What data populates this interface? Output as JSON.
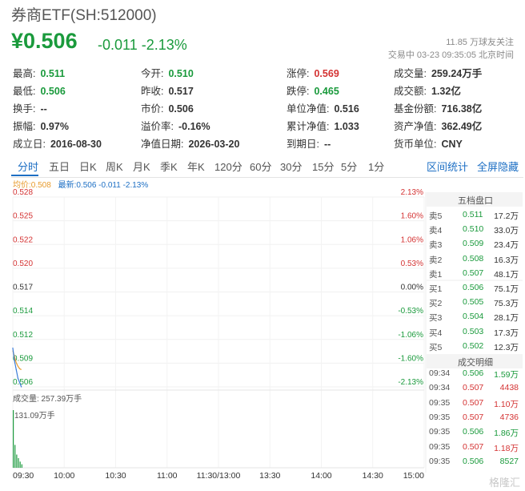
{
  "header": {
    "title": "券商ETF(SH:512000)",
    "price": "¥0.506",
    "change": "-0.011 -2.13%",
    "followers": "11.85 万球友关注",
    "status": "交易中 03-23 09:35:05 北京时间"
  },
  "quote": {
    "row1": [
      {
        "label": "最高:",
        "value": "0.511",
        "color": "#1a9a3c"
      },
      {
        "label": "今开:",
        "value": "0.510",
        "color": "#1a9a3c"
      },
      {
        "label": "涨停:",
        "value": "0.569",
        "color": "#d43333"
      },
      {
        "label": "成交量:",
        "value": "259.24万手",
        "color": "#333333"
      }
    ],
    "row2": [
      {
        "label": "最低:",
        "value": "0.506",
        "color": "#1a9a3c"
      },
      {
        "label": "昨收:",
        "value": "0.517",
        "color": "#333333"
      },
      {
        "label": "跌停:",
        "value": "0.465",
        "color": "#1a9a3c"
      },
      {
        "label": "成交额:",
        "value": "1.32亿",
        "color": "#333333"
      }
    ],
    "row3": [
      {
        "label": "换手:",
        "value": "--",
        "color": "#333333"
      },
      {
        "label": "市价:",
        "value": "0.506",
        "color": "#333333"
      },
      {
        "label": "单位净值:",
        "value": "0.516",
        "color": "#333333"
      },
      {
        "label": "基金份额:",
        "value": "716.38亿",
        "color": "#333333"
      }
    ],
    "row4": [
      {
        "label": "振幅:",
        "value": "0.97%",
        "color": "#333333"
      },
      {
        "label": "溢价率:",
        "value": "-0.16%",
        "color": "#333333"
      },
      {
        "label": "累计净值:",
        "value": "1.033",
        "color": "#333333"
      },
      {
        "label": "资产净值:",
        "value": "362.49亿",
        "color": "#333333"
      }
    ],
    "row5": [
      {
        "label": "成立日:",
        "value": "2016-08-30",
        "color": "#333333"
      },
      {
        "label": "净值日期:",
        "value": "2026-03-20",
        "color": "#333333"
      },
      {
        "label": "到期日:",
        "value": "--",
        "color": "#333333"
      },
      {
        "label": "货币单位:",
        "value": "CNY",
        "color": "#333333"
      }
    ]
  },
  "tabs": [
    "分时",
    "五日",
    "日K",
    "周K",
    "月K",
    "季K",
    "年K",
    "120分",
    "60分",
    "30分",
    "15分",
    "5分",
    "1分"
  ],
  "tabs_right": [
    "区间统计",
    "全屏隐藏"
  ],
  "legend": {
    "avg": "均价:0.508",
    "latest": "最新:0.506 -0.011 -2.13%"
  },
  "volume_label": "成交量: 257.39万手",
  "volume_axis_label": "131.09万手",
  "order_book": {
    "title": "五档盘口",
    "rows": [
      {
        "label": "卖5",
        "price": "0.511",
        "qty": "17.2万",
        "color": "#1a9a3c"
      },
      {
        "label": "卖4",
        "price": "0.510",
        "qty": "33.0万",
        "color": "#1a9a3c"
      },
      {
        "label": "卖3",
        "price": "0.509",
        "qty": "23.4万",
        "color": "#1a9a3c"
      },
      {
        "label": "卖2",
        "price": "0.508",
        "qty": "16.3万",
        "color": "#1a9a3c"
      },
      {
        "label": "卖1",
        "price": "0.507",
        "qty": "48.1万",
        "color": "#1a9a3c"
      },
      {
        "label": "买1",
        "price": "0.506",
        "qty": "75.1万",
        "color": "#1a9a3c"
      },
      {
        "label": "买2",
        "price": "0.505",
        "qty": "75.3万",
        "color": "#1a9a3c"
      },
      {
        "label": "买3",
        "price": "0.504",
        "qty": "28.1万",
        "color": "#1a9a3c"
      },
      {
        "label": "买4",
        "price": "0.503",
        "qty": "17.3万",
        "color": "#1a9a3c"
      },
      {
        "label": "买5",
        "price": "0.502",
        "qty": "12.3万",
        "color": "#1a9a3c"
      }
    ]
  },
  "trades": {
    "title": "成交明细",
    "rows": [
      {
        "time": "09:34",
        "price": "0.506",
        "vol": "1.59万",
        "color": "#1a9a3c"
      },
      {
        "time": "09:34",
        "price": "0.507",
        "vol": "4438",
        "color": "#d43333"
      },
      {
        "time": "09:35",
        "price": "0.507",
        "vol": "1.10万",
        "color": "#d43333"
      },
      {
        "time": "09:35",
        "price": "0.507",
        "vol": "4736",
        "color": "#d43333"
      },
      {
        "time": "09:35",
        "price": "0.506",
        "vol": "1.86万",
        "color": "#1a9a3c"
      },
      {
        "time": "09:35",
        "price": "0.507",
        "vol": "1.18万",
        "color": "#d43333"
      },
      {
        "time": "09:35",
        "price": "0.506",
        "vol": "8527",
        "color": "#1a9a3c"
      }
    ]
  },
  "watermark": "格隆汇",
  "chart_data": {
    "type": "line",
    "price_ticks": [
      "0.528",
      "0.525",
      "0.522",
      "0.520",
      "0.517",
      "0.514",
      "0.512",
      "0.509",
      "0.506"
    ],
    "pct_ticks": [
      "2.13%",
      "1.60%",
      "1.06%",
      "0.53%",
      "0.00%",
      "-0.53%",
      "-1.06%",
      "-1.60%",
      "-2.13%"
    ],
    "x_ticks": [
      "09:30",
      "10:00",
      "10:30",
      "11:00",
      "11:30/13:00",
      "13:30",
      "14:00",
      "14:30",
      "15:00"
    ],
    "ylim": [
      0.506,
      0.528
    ],
    "prev_close": 0.517,
    "price_series": [
      {
        "minute": 0,
        "value": 0.5105
      },
      {
        "minute": 1,
        "value": 0.509
      },
      {
        "minute": 2,
        "value": 0.508
      },
      {
        "minute": 3,
        "value": 0.507
      },
      {
        "minute": 4,
        "value": 0.5065
      },
      {
        "minute": 5,
        "value": 0.506
      }
    ],
    "avg_series": [
      {
        "minute": 0,
        "value": 0.5102
      },
      {
        "minute": 1,
        "value": 0.5095
      },
      {
        "minute": 2,
        "value": 0.5088
      },
      {
        "minute": 3,
        "value": 0.5084
      },
      {
        "minute": 4,
        "value": 0.5081
      },
      {
        "minute": 5,
        "value": 0.508
      }
    ],
    "volume_unit": "万手",
    "volume_max": 131.09,
    "volume_bars": [
      131.09,
      52.0,
      30.0,
      22.0,
      14.0,
      8.0
    ]
  }
}
